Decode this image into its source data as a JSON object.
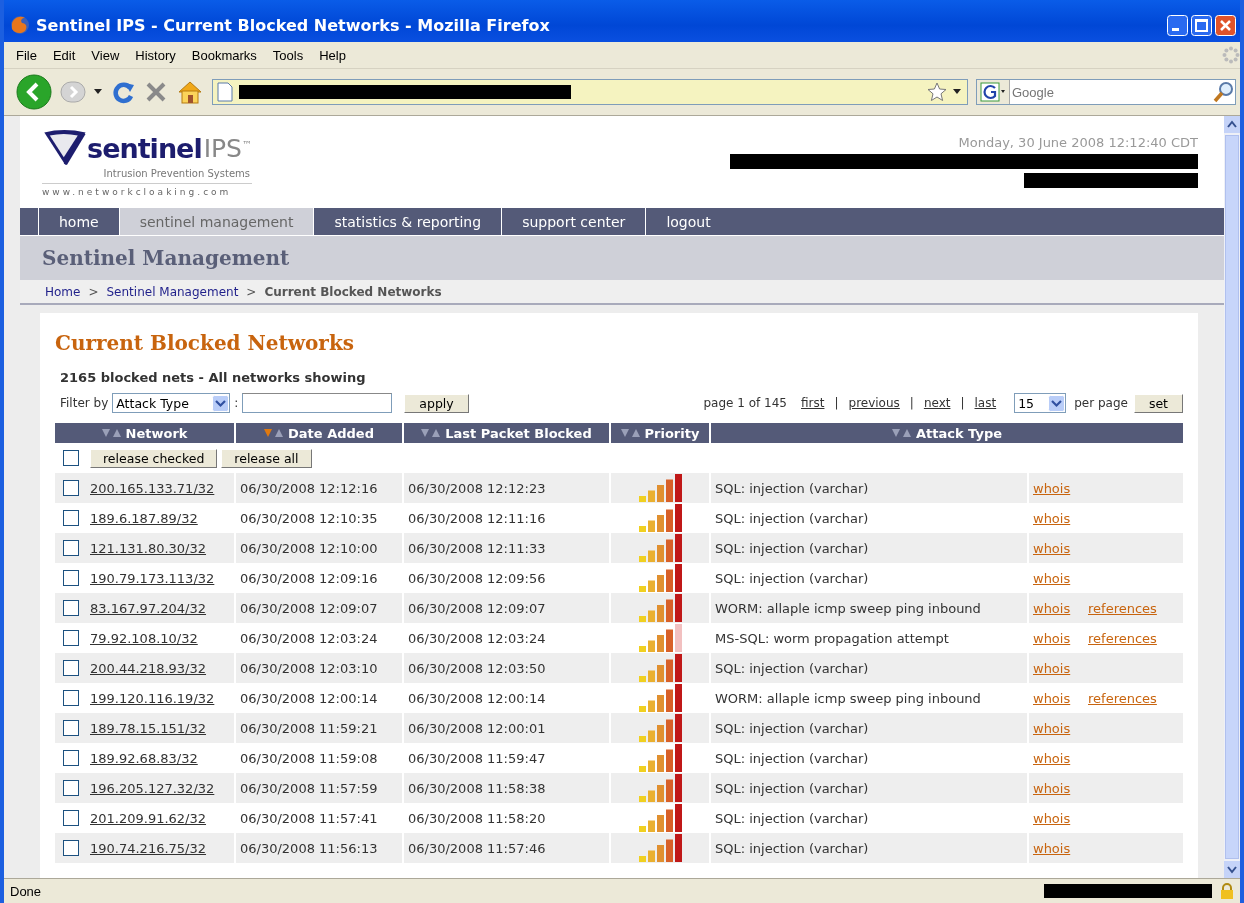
{
  "window": {
    "title": "Sentinel IPS - Current Blocked Networks - Mozilla Firefox"
  },
  "menu": [
    "File",
    "Edit",
    "View",
    "History",
    "Bookmarks",
    "Tools",
    "Help"
  ],
  "toolbar": {
    "search_placeholder": "Google"
  },
  "header": {
    "brand": "sentinel",
    "brand_suffix": "IPS$^{™}$",
    "tagline": "Intrusion Prevention Systems",
    "site": "www.networkcloaking.com",
    "date": "Monday, 30 June 2008 12:12:40 CDT"
  },
  "tabs": [
    {
      "label": "home",
      "selected": false
    },
    {
      "label": "sentinel management",
      "selected": true
    },
    {
      "label": "statistics & reporting",
      "selected": false
    },
    {
      "label": "support center",
      "selected": false
    },
    {
      "label": "logout",
      "selected": false
    }
  ],
  "page_title": "Sentinel Management",
  "breadcrumb": [
    {
      "label": "Home",
      "kind": "link"
    },
    {
      "label": ">",
      "kind": "separator"
    },
    {
      "label": "Sentinel Management",
      "kind": "link"
    },
    {
      "label": ">",
      "kind": "separator"
    },
    {
      "label": "Current Blocked Networks",
      "kind": "current"
    }
  ],
  "section_title": "Current Blocked Networks",
  "summary": "2165 blocked nets - All networks showing",
  "filter": {
    "label": "Filter by",
    "field": "Attack Type",
    "colon": ":",
    "button": "apply"
  },
  "pagination": {
    "info": "page 1 of 145",
    "links": [
      "first",
      "previous",
      "next",
      "last"
    ],
    "separator": "|",
    "per_page_value": "15",
    "per_page_label": "per page",
    "button": "set"
  },
  "table": {
    "columns": [
      {
        "label": "Network",
        "sorted": false
      },
      {
        "label": "Date Added",
        "sorted": true
      },
      {
        "label": "Last Packet Blocked",
        "sorted": false
      },
      {
        "label": "Priority",
        "sorted": false
      },
      {
        "label": "Attack Type",
        "sorted": false
      }
    ],
    "select_all": {
      "checked": false
    },
    "actions": [
      "release checked",
      "release all"
    ],
    "rows": [
      {
        "checked": false,
        "network": "200.165.133.71/32",
        "added": "06/30/2008 12:12:16",
        "last": "06/30/2008 12:12:23",
        "kind": "high",
        "attack": "SQL: injection (varchar)",
        "whois": "whois"
      },
      {
        "checked": false,
        "network": "189.6.187.89/32",
        "added": "06/30/2008 12:10:35",
        "last": "06/30/2008 12:11:16",
        "kind": "high",
        "attack": "SQL: injection (varchar)",
        "whois": "whois"
      },
      {
        "checked": false,
        "network": "121.131.80.30/32",
        "added": "06/30/2008 12:10:00",
        "last": "06/30/2008 12:11:33",
        "kind": "high",
        "attack": "SQL: injection (varchar)",
        "whois": "whois"
      },
      {
        "checked": false,
        "network": "190.79.173.113/32",
        "added": "06/30/2008 12:09:16",
        "last": "06/30/2008 12:09:56",
        "kind": "high",
        "attack": "SQL: injection (varchar)",
        "whois": "whois"
      },
      {
        "checked": false,
        "network": "83.167.97.204/32",
        "added": "06/30/2008 12:09:07",
        "last": "06/30/2008 12:09:07",
        "kind": "high",
        "attack": "WORM: allaple icmp sweep ping inbound",
        "whois": "whois",
        "references": "references"
      },
      {
        "checked": false,
        "network": "79.92.108.10/32",
        "added": "06/30/2008 12:03:24",
        "last": "06/30/2008 12:03:24",
        "kind": "medium",
        "attack": "MS-SQL: worm propagation attempt",
        "whois": "whois",
        "references": "references"
      },
      {
        "checked": false,
        "network": "200.44.218.93/32",
        "added": "06/30/2008 12:03:10",
        "last": "06/30/2008 12:03:50",
        "kind": "high",
        "attack": "SQL: injection (varchar)",
        "whois": "whois"
      },
      {
        "checked": false,
        "network": "199.120.116.19/32",
        "added": "06/30/2008 12:00:14",
        "last": "06/30/2008 12:00:14",
        "kind": "high",
        "attack": "WORM: allaple icmp sweep ping inbound",
        "whois": "whois",
        "references": "references"
      },
      {
        "checked": false,
        "network": "189.78.15.151/32",
        "added": "06/30/2008 11:59:21",
        "last": "06/30/2008 12:00:01",
        "kind": "high",
        "attack": "SQL: injection (varchar)",
        "whois": "whois"
      },
      {
        "checked": false,
        "network": "189.92.68.83/32",
        "added": "06/30/2008 11:59:08",
        "last": "06/30/2008 11:59:47",
        "kind": "high",
        "attack": "SQL: injection (varchar)",
        "whois": "whois"
      },
      {
        "checked": false,
        "network": "196.205.127.32/32",
        "added": "06/30/2008 11:57:59",
        "last": "06/30/2008 11:58:38",
        "kind": "high",
        "attack": "SQL: injection (varchar)",
        "whois": "whois"
      },
      {
        "checked": false,
        "network": "201.209.91.62/32",
        "added": "06/30/2008 11:57:41",
        "last": "06/30/2008 11:58:20",
        "kind": "high",
        "attack": "SQL: injection (varchar)",
        "whois": "whois"
      },
      {
        "checked": false,
        "network": "190.74.216.75/32",
        "added": "06/30/2008 11:56:13",
        "last": "06/30/2008 11:57:46",
        "kind": "high",
        "attack": "SQL: injection (varchar)",
        "whois": "whois"
      }
    ]
  },
  "status_bar": {
    "text": "Done"
  }
}
